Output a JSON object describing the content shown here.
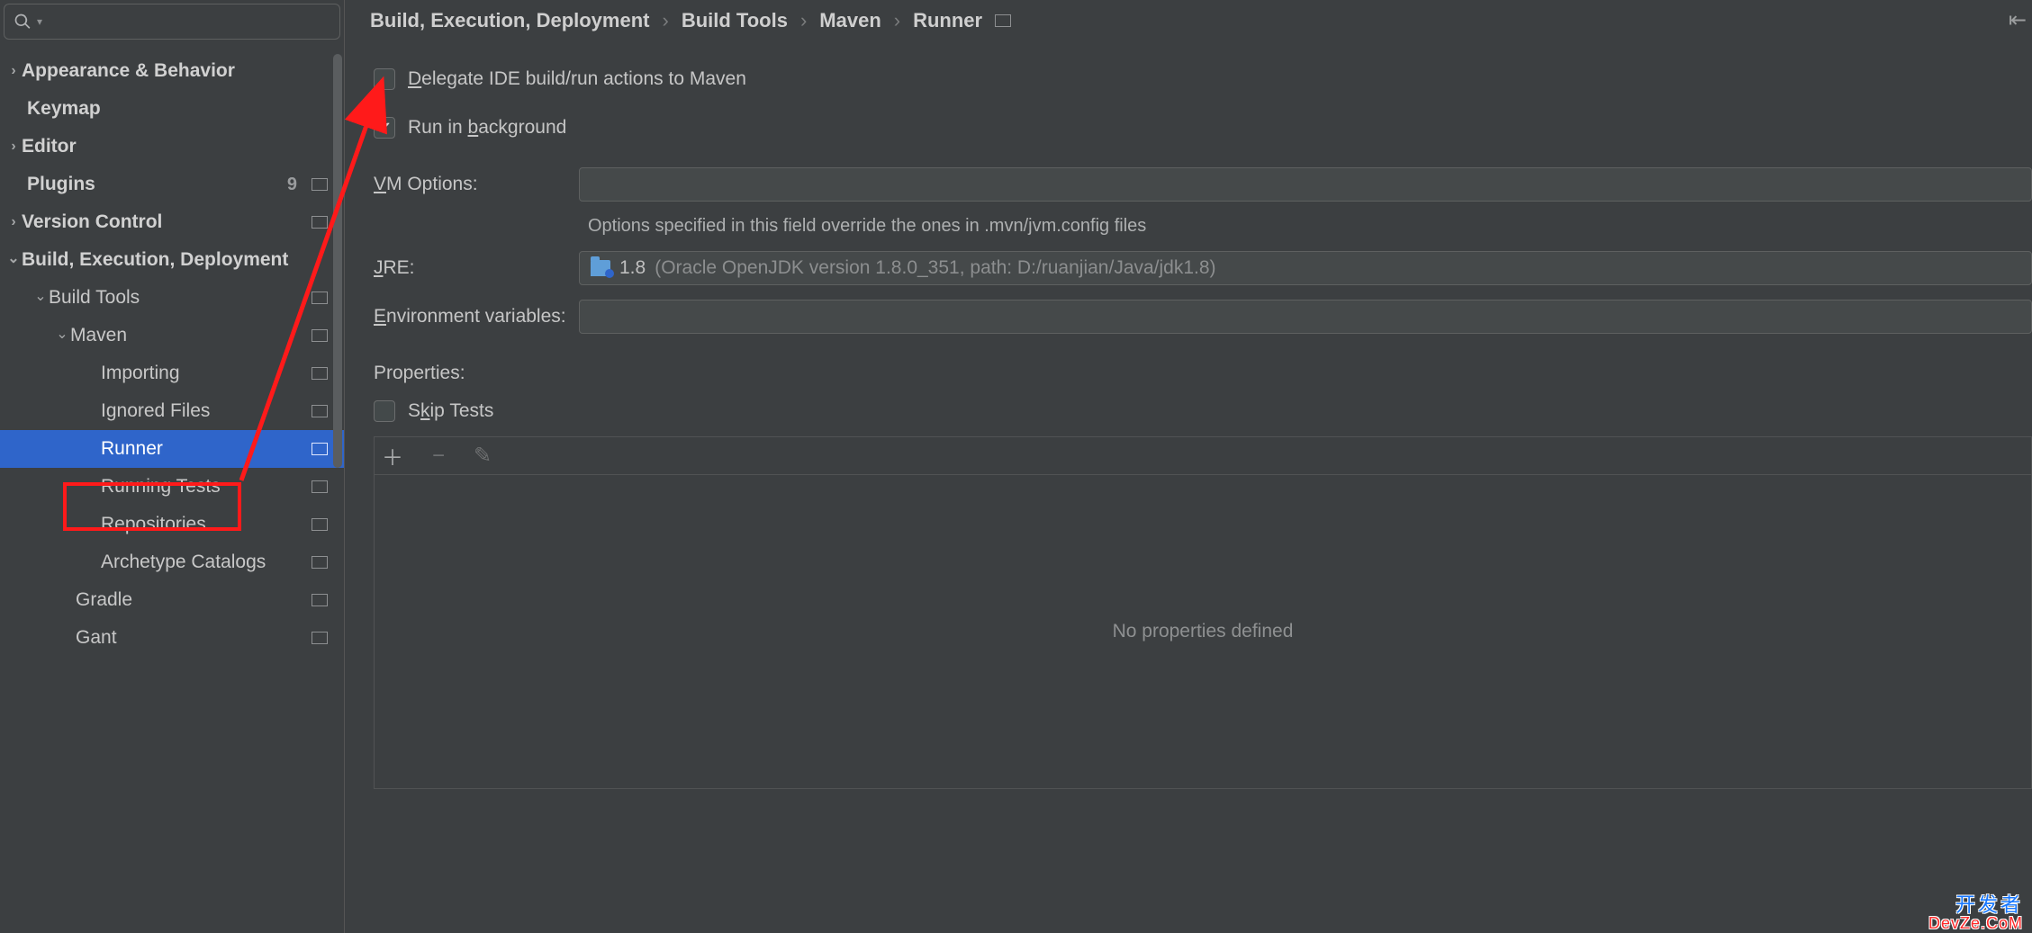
{
  "sidebar": {
    "search_placeholder": "",
    "items": {
      "appearance": "Appearance & Behavior",
      "keymap": "Keymap",
      "editor": "Editor",
      "plugins": "Plugins",
      "plugins_count": "9",
      "version_control": "Version Control",
      "bed": "Build, Execution, Deployment",
      "build_tools": "Build Tools",
      "maven": "Maven",
      "importing": "Importing",
      "ignored_files": "Ignored Files",
      "runner": "Runner",
      "running_tests": "Running Tests",
      "repositories": "Repositories",
      "archetype": "Archetype Catalogs",
      "gradle": "Gradle",
      "gant": "Gant"
    }
  },
  "breadcrumbs": {
    "a": "Build, Execution, Deployment",
    "b": "Build Tools",
    "c": "Maven",
    "d": "Runner"
  },
  "form": {
    "delegate_pre": "D",
    "delegate_rest": "elegate IDE build/run actions to Maven",
    "run_bg_pre": "Run in ",
    "run_bg_u": "b",
    "run_bg_rest": "ackground",
    "vm_u": "V",
    "vm_rest": "M Options:",
    "vm_hint": "Options specified in this field override the ones in .mvn/jvm.config files",
    "jre_u": "J",
    "jre_rest": "RE:",
    "jre_value": "1.8",
    "jre_hint": "(Oracle OpenJDK version 1.8.0_351, path: D:/ruanjian/Java/jdk1.8)",
    "env_u": "E",
    "env_rest": "nvironment variables:",
    "props_title": "Properties:",
    "skip_pre": "S",
    "skip_u": "k",
    "skip_rest": "ip Tests",
    "no_props": "No properties defined"
  },
  "watermark": {
    "l1": "开发者",
    "l2": "DevZe.CoM"
  }
}
